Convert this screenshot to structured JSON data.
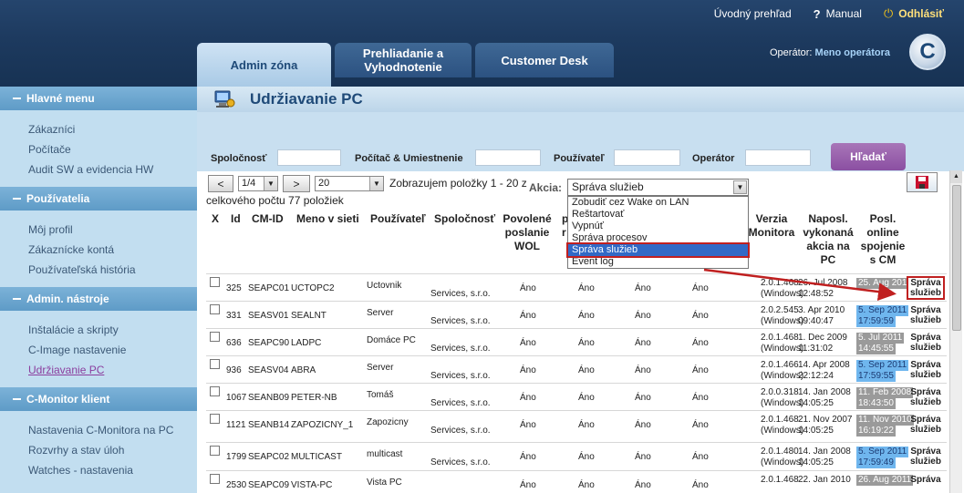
{
  "topbar": {
    "links": {
      "overview": "Úvodný prehľad",
      "manual": "Manual",
      "logout": "Odhlásiť"
    },
    "tabs": [
      "Admin zóna",
      "Prehliadanie a Vyhodnotenie",
      "Customer Desk"
    ],
    "operator_label": "Operátor:",
    "operator_name": "Meno operátora",
    "logo_letter": "C"
  },
  "sidebar": {
    "sections": [
      {
        "title": "Hlavné menu",
        "items": [
          "Zákazníci",
          "Počítače",
          "Audit SW a evidencia HW"
        ]
      },
      {
        "title": "Používatelia",
        "items": [
          "Môj profil",
          "Zákaznícke kontá",
          "Používateľská história"
        ]
      },
      {
        "title": "Admin. nástroje",
        "items": [
          "Inštalácie a skripty",
          "C-Image nastavenie",
          "Udržiavanie PC"
        ]
      },
      {
        "title": "C-Monitor klient",
        "items": [
          "Nastavenia C-Monitora na PC",
          "Rozvrhy a stav úloh",
          "Watches - nastavenia"
        ]
      }
    ],
    "selected": "Udržiavanie PC"
  },
  "page": {
    "title": "Udržiavanie PC",
    "filters": {
      "company": "Spoločnosť",
      "computer": "Počítač & Umiestnenie",
      "user": "Používateľ",
      "operator": "Operátor",
      "search_button": "Hľadať"
    },
    "pager": {
      "prev": "<",
      "page": "1/4",
      "next": ">",
      "page_size": "20",
      "showing": "Zobrazujem položky 1 - 20 z",
      "total": "celkového počtu 77 položiek"
    },
    "action": {
      "label": "Akcia:",
      "selected": "Správa služieb",
      "options": [
        "Zobudiť cez Wake on LAN",
        "Reštartovať",
        "Vypnúť",
        "Správa procesov",
        "Správa služieb",
        "Event log"
      ]
    }
  },
  "table": {
    "headers": {
      "x": "X",
      "id": "Id",
      "cmid": "CM-ID",
      "name": "Meno v sieti",
      "user": "Používateľ",
      "company": "Spoločnosť",
      "wol": "Povolené poslanie WOL",
      "col8_a": "p",
      "col8_b": "r",
      "version": "Verzia Monitora",
      "lastaction": "Naposl. vykonaná akcia na PC",
      "lastonline": "Posl. online spojenie s CM"
    },
    "rows": [
      {
        "id": "325",
        "cmid": "SEAPC01",
        "name": "UCTOPC2",
        "user": "Uctovnik",
        "company": "Services, s.r.o.",
        "c1": "Áno",
        "c2": "Áno",
        "c3": "Áno",
        "c4": "Áno",
        "version": "2.0.1.468",
        "platform": "(Windows)",
        "last_action": "26. Jul 2008",
        "last_action_time": "12:48:52",
        "online": "25. Aug 2011",
        "online_time": "",
        "online_style": "grey",
        "action": "Správa služieb"
      },
      {
        "id": "331",
        "cmid": "SEASV01",
        "name": "SEALNT",
        "user": "Server",
        "company": "Services, s.r.o.",
        "c1": "Áno",
        "c2": "Áno",
        "c3": "Áno",
        "c4": "Áno",
        "version": "2.0.2.545",
        "platform": "(Windows)",
        "last_action": "3. Apr 2010",
        "last_action_time": "09:40:47",
        "online": "5. Sep 2011",
        "online_time": "17:59:59",
        "online_style": "blue",
        "action": "Správa služieb"
      },
      {
        "id": "636",
        "cmid": "SEAPC90",
        "name": "LADPC",
        "user": "Domáce PC",
        "company": "Services, s.r.o.",
        "c1": "Áno",
        "c2": "Áno",
        "c3": "Áno",
        "c4": "Áno",
        "version": "2.0.1.468",
        "platform": "(Windows)",
        "last_action": "1. Dec 2009",
        "last_action_time": "11:31:02",
        "online": "5. Jul 2011",
        "online_time": "14:45:55",
        "online_style": "grey",
        "action": "Správa služieb"
      },
      {
        "id": "936",
        "cmid": "SEASV04",
        "name": "ABRA",
        "user": "Server",
        "company": "Services, s.r.o.",
        "c1": "Áno",
        "c2": "Áno",
        "c3": "Áno",
        "c4": "Áno",
        "version": "2.0.1.466",
        "platform": "(Windows)",
        "last_action": "14. Apr 2008",
        "last_action_time": "22:12:24",
        "online": "5. Sep 2011",
        "online_time": "17:59:55",
        "online_style": "blue",
        "action": "Správa služieb"
      },
      {
        "id": "1067",
        "cmid": "SEANB09",
        "name": "PETER-NB",
        "user": "Tomáš",
        "company": "Services, s.r.o.",
        "c1": "Áno",
        "c2": "Áno",
        "c3": "Áno",
        "c4": "Áno",
        "version": "2.0.0.318",
        "platform": "(Windows)",
        "last_action": "14. Jan 2008",
        "last_action_time": "14:05:25",
        "online": "11. Feb 2008",
        "online_time": "18:43:50",
        "online_style": "grey",
        "action": "Správa služieb"
      },
      {
        "id": "1121",
        "cmid": "SEANB14",
        "name": "ZAPOZICNY_1",
        "user": "Zapozicny",
        "company": "Services, s.r.o.",
        "c1": "Áno",
        "c2": "Áno",
        "c3": "Áno",
        "c4": "Áno",
        "version": "2.0.1.468",
        "platform": "(Windows)",
        "last_action": "21. Nov 2007",
        "last_action_time": "14:05:25",
        "online": "11. Nov 2010",
        "online_time": "16:19:22",
        "online_style": "grey",
        "action": "Správa služieb"
      },
      {
        "id": "1799",
        "cmid": "SEAPC02",
        "name": "MULTICAST",
        "user": "multicast",
        "company": "Services, s.r.o.",
        "c1": "Áno",
        "c2": "Áno",
        "c3": "Áno",
        "c4": "Áno",
        "version": "2.0.1.480",
        "platform": "(Windows)",
        "last_action": "14. Jan 2008",
        "last_action_time": "14:05:25",
        "online": "5. Sep 2011",
        "online_time": "17:59:49",
        "online_style": "blue",
        "action": "Správa služieb"
      },
      {
        "id": "2530",
        "cmid": "SEAPC09",
        "name": "VISTA-PC",
        "user": "Vista PC",
        "company": "",
        "c1": "Áno",
        "c2": "Áno",
        "c3": "Áno",
        "c4": "Áno",
        "version": "2.0.1.468",
        "platform": "",
        "last_action": "22. Jan 2010",
        "last_action_time": "",
        "online": "26. Aug 2011",
        "online_time": "",
        "online_style": "grey",
        "action": "Správa"
      }
    ]
  }
}
